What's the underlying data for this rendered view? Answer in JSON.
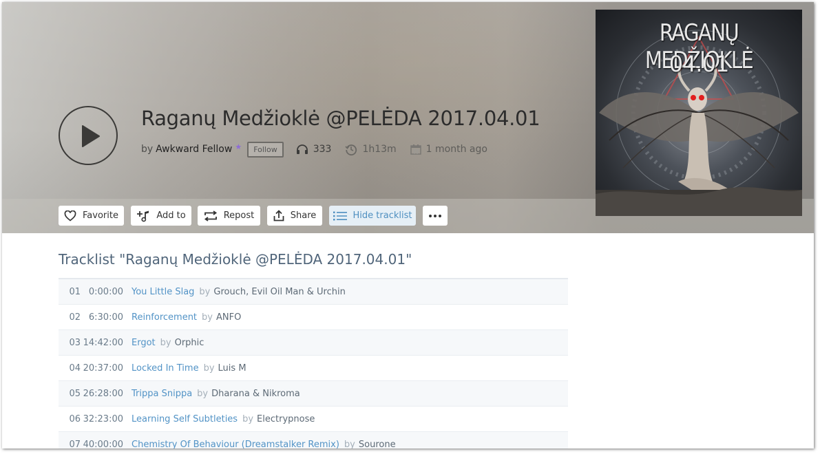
{
  "cloudcast": {
    "title": "Raganų Medžioklė @PELĖDA 2017.04.01",
    "by_label": "by",
    "user": "Awkward Fellow",
    "premium_badge": "★",
    "follow_label": "Follow",
    "plays": "333",
    "duration": "1h13m",
    "uploaded": "1 month ago"
  },
  "cover": {
    "line1": "RAGANŲ MEDŽIOKLĖ",
    "line2": "04.01"
  },
  "actions": {
    "favorite": "Favorite",
    "add_to": "Add to",
    "repost": "Repost",
    "share": "Share",
    "hide_tracklist": "Hide tracklist"
  },
  "tracklist": {
    "heading": "Tracklist \"Raganų Medžioklė @PELĖDA 2017.04.01\"",
    "by_label": "by",
    "tracks": [
      {
        "num": "01",
        "time": "0:00:00",
        "name": "You Little Slag",
        "artist": "Grouch, Evil Oil Man & Urchin"
      },
      {
        "num": "02",
        "time": "6:30:00",
        "name": "Reinforcement",
        "artist": "ANFO"
      },
      {
        "num": "03",
        "time": "14:42:00",
        "name": "Ergot",
        "artist": "Orphic"
      },
      {
        "num": "04",
        "time": "20:37:00",
        "name": "Locked In Time",
        "artist": "Luis M"
      },
      {
        "num": "05",
        "time": "26:28:00",
        "name": "Trippa Snippa",
        "artist": "Dharana & Nikroma"
      },
      {
        "num": "06",
        "time": "32:23:00",
        "name": "Learning Self Subtleties",
        "artist": "Electrypnose"
      },
      {
        "num": "07",
        "time": "40:00:00",
        "name": "Chemistry Of Behaviour (Dreamstalker Remix)",
        "artist": "Sourone"
      }
    ]
  },
  "colors": {
    "link_blue": "#5293c6",
    "premium_purple": "#8d6bd8",
    "hide_tracklist_bg": "#e6eff6"
  },
  "icons": [
    "play-icon",
    "headphones-icon",
    "clock-history-icon",
    "calendar-icon",
    "heart-icon",
    "add-to-playlist-icon",
    "repost-icon",
    "share-icon",
    "list-icon",
    "more-icon"
  ]
}
